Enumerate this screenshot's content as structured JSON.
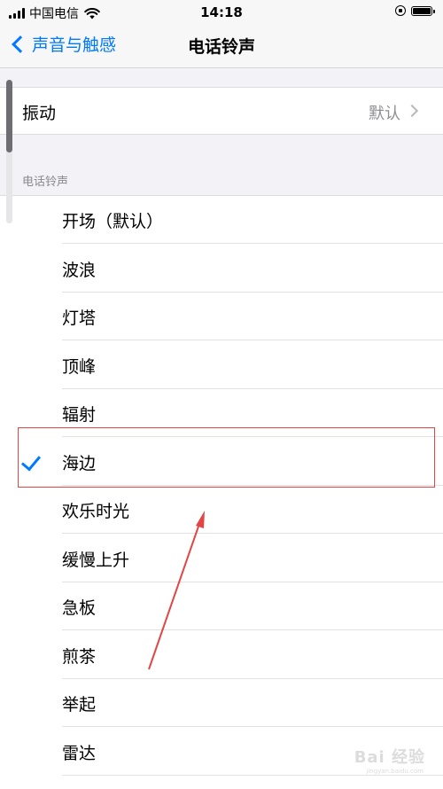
{
  "status_bar": {
    "carrier": "中国电信",
    "time": "14:18",
    "battery_level": 1.0
  },
  "nav": {
    "back_label": "声音与触感",
    "title": "电话铃声"
  },
  "vibration": {
    "label": "振动",
    "value": "默认"
  },
  "section": {
    "header": "电话铃声"
  },
  "ringtones": [
    {
      "name": "开场（默认）",
      "selected": false
    },
    {
      "name": "波浪",
      "selected": false
    },
    {
      "name": "灯塔",
      "selected": false
    },
    {
      "name": "顶峰",
      "selected": false
    },
    {
      "name": "辐射",
      "selected": false
    },
    {
      "name": "海边",
      "selected": true
    },
    {
      "name": "欢乐时光",
      "selected": false
    },
    {
      "name": "缓慢上升",
      "selected": false
    },
    {
      "name": "急板",
      "selected": false
    },
    {
      "name": "煎茶",
      "selected": false
    },
    {
      "name": "举起",
      "selected": false
    },
    {
      "name": "雷达",
      "selected": false
    }
  ],
  "watermark": {
    "text": "Bai 经验",
    "subtext": "jingyan.baidu.com"
  },
  "colors": {
    "accent": "#007aff",
    "annotation": "#e34545"
  }
}
